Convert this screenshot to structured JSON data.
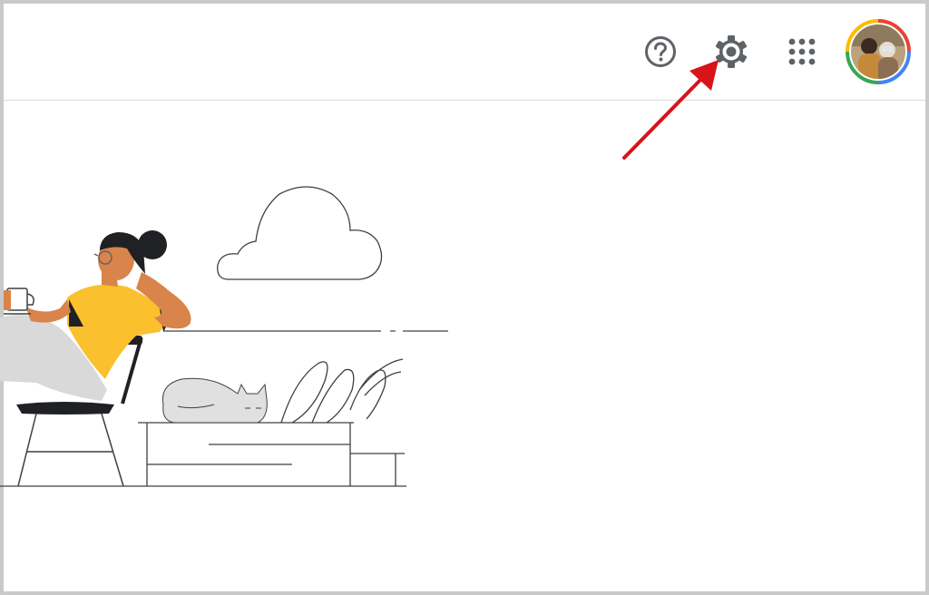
{
  "header": {
    "actions": [
      {
        "id": "help",
        "icon": "help-circle-icon"
      },
      {
        "id": "settings",
        "icon": "gear-icon"
      },
      {
        "id": "apps",
        "icon": "apps-grid-icon"
      }
    ],
    "avatar": {
      "icon": "profile-avatar"
    }
  },
  "annotation": {
    "type": "arrow",
    "target": "settings",
    "color": "#d7141a"
  },
  "colors": {
    "icon": "#5f6368",
    "divider": "#dadce0",
    "person_shirt": "#fbc02d",
    "person_skin": "#d9844a",
    "person_hair": "#202124",
    "cat": "#e0e0e0",
    "line_art": "#3c4043",
    "google_blue": "#4285f4",
    "google_red": "#ea4335",
    "google_yellow": "#fbbc05",
    "google_green": "#34a853"
  }
}
